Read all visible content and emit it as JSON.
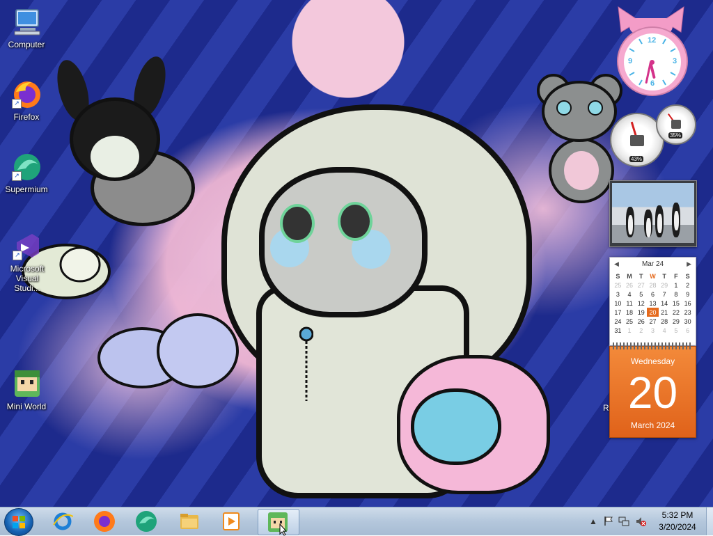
{
  "desktop": {
    "icons": [
      {
        "label": "Computer",
        "icon": "computer-icon"
      },
      {
        "label": "Firefox",
        "icon": "firefox-icon"
      },
      {
        "label": "Supermium",
        "icon": "supermium-icon"
      },
      {
        "label": "Microsoft Visual Studi...",
        "icon": "visual-studio-icon"
      },
      {
        "label": "Mini World",
        "icon": "mini-world-icon"
      }
    ],
    "partial_label": "R"
  },
  "gadgets": {
    "clock": {
      "hour": 5,
      "minute": 32,
      "numerals": {
        "twelve": "12",
        "three": "3",
        "six": "6",
        "nine": "9"
      }
    },
    "meter": {
      "cpu": "43%",
      "memory": "35%",
      "cpu_value": 43,
      "memory_value": 35
    },
    "slideshow": {
      "subject": "penguins-photo"
    },
    "calendar": {
      "month_header": "Mar 24",
      "weekdays": [
        "S",
        "M",
        "T",
        "W",
        "T",
        "F",
        "S"
      ],
      "today_col": 3,
      "weeks": [
        [
          "25",
          "26",
          "27",
          "28",
          "29",
          "1",
          "2"
        ],
        [
          "3",
          "4",
          "5",
          "6",
          "7",
          "8",
          "9"
        ],
        [
          "10",
          "11",
          "12",
          "13",
          "14",
          "15",
          "16"
        ],
        [
          "17",
          "18",
          "19",
          "20",
          "21",
          "22",
          "23"
        ],
        [
          "24",
          "25",
          "26",
          "27",
          "28",
          "29",
          "30"
        ],
        [
          "31",
          "1",
          "2",
          "3",
          "4",
          "5",
          "6"
        ]
      ],
      "weekday_name": "Wednesday",
      "day_number": "20",
      "month_year": "March 2024"
    }
  },
  "taskbar": {
    "pinned": [
      {
        "name": "internet-explorer",
        "color": "#1e7fd6"
      },
      {
        "name": "firefox",
        "color": "#ff7a1a"
      },
      {
        "name": "supermium",
        "color": "#1fa37a"
      },
      {
        "name": "file-explorer",
        "color": "#e8b84a"
      },
      {
        "name": "media-player",
        "color": "#f08a1c"
      },
      {
        "name": "mini-world",
        "color": "#5fb75a"
      }
    ],
    "tray": {
      "time": "5:32 PM",
      "date": "3/20/2024"
    }
  },
  "colors": {
    "accent": "#e56a1d",
    "taskbar": "#b4c7dc",
    "desktop_blue": "#22318f"
  }
}
